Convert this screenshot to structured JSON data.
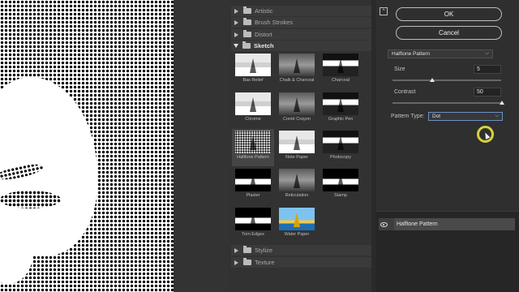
{
  "gallery": {
    "categories_top": [
      {
        "label": "Artistic"
      },
      {
        "label": "Brush Strokes"
      },
      {
        "label": "Distort"
      },
      {
        "label": "Sketch"
      }
    ],
    "thumbnails": [
      {
        "label": "Bas Relief",
        "style": "light"
      },
      {
        "label": "Chalk & Charcoal",
        "style": "gray"
      },
      {
        "label": "Charcoal",
        "style": "dark"
      },
      {
        "label": "Chrome",
        "style": "light"
      },
      {
        "label": "Conté Crayon",
        "style": "gray"
      },
      {
        "label": "Graphic Pen",
        "style": "dark"
      },
      {
        "label": "Halftone Pattern",
        "style": "dot"
      },
      {
        "label": "Note Paper",
        "style": "light"
      },
      {
        "label": "Photocopy",
        "style": "dark"
      },
      {
        "label": "Plaster",
        "style": "bw"
      },
      {
        "label": "Reticulation",
        "style": "gray"
      },
      {
        "label": "Stamp",
        "style": "bw"
      },
      {
        "label": "Torn Edges",
        "style": "bw"
      },
      {
        "label": "Water Paper",
        "style": "water"
      }
    ],
    "categories_bottom": [
      {
        "label": "Stylize"
      },
      {
        "label": "Texture"
      }
    ]
  },
  "panel": {
    "collapse_icon": "⌃",
    "ok_label": "OK",
    "cancel_label": "Cancel",
    "filter_select": "Halftone Pattern",
    "size_label": "Size",
    "size_value": "5",
    "contrast_label": "Contrast",
    "contrast_value": "50",
    "pattern_label": "Pattern Type:",
    "pattern_value": "Dot"
  },
  "layers": {
    "row_label": "Halftone Pattern"
  }
}
